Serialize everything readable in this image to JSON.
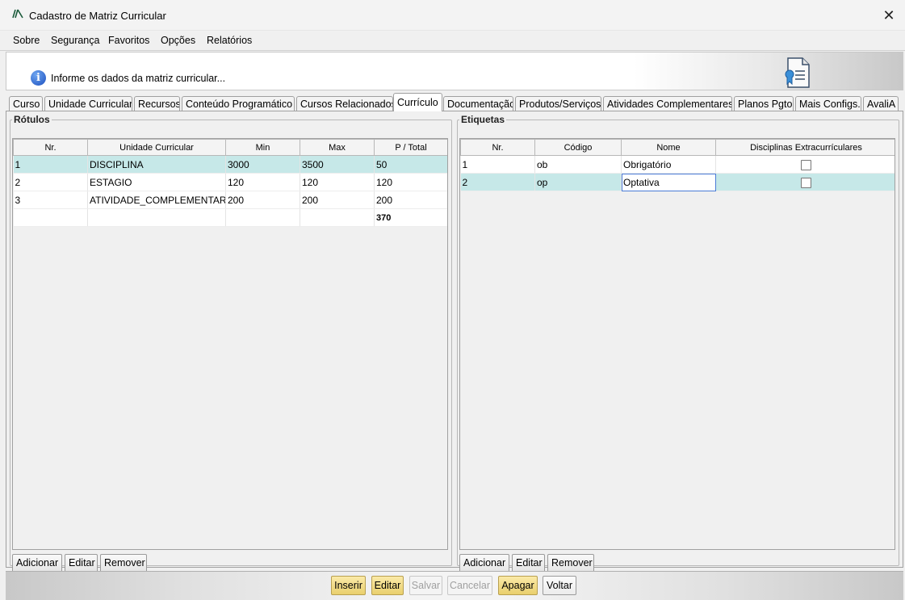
{
  "window": {
    "title": "Cadastro de Matriz Curricular",
    "close_glyph": "✕"
  },
  "menu": [
    "Sobre",
    "Segurança",
    "Favoritos",
    "Opções",
    "Relatórios"
  ],
  "info": {
    "message": "Informe os dados da matriz curricular..."
  },
  "tabs": [
    "Curso",
    "Unidade Curricular",
    "Recursos",
    "Conteúdo Programático",
    "Cursos Relacionados",
    "Currículo",
    "Documentação",
    "Produtos/Serviços",
    "Atividades Complementares",
    "Planos Pgto",
    "Mais Configs.",
    "AvaliA"
  ],
  "active_tab": "Currículo",
  "rotulos": {
    "legend": "Rótulos",
    "headers": [
      "Nr.",
      "Unidade Curricular",
      "Min",
      "Max",
      "P / Total"
    ],
    "rows": [
      [
        "1",
        "DISCIPLINA",
        "3000",
        "3500",
        "50"
      ],
      [
        "2",
        "ESTAGIO",
        "120",
        "120",
        "120"
      ],
      [
        "3",
        "ATIVIDADE_COMPLEMENTAR",
        "200",
        "200",
        "200"
      ]
    ],
    "total": "370",
    "selected_row": 0,
    "buttons": [
      "Adicionar",
      "Editar",
      "Remover"
    ]
  },
  "etiquetas": {
    "legend": "Etiquetas",
    "headers": [
      "Nr.",
      "Código",
      "Nome",
      "Disciplinas Extracurrículares"
    ],
    "rows": [
      {
        "nr": "1",
        "codigo": "ob",
        "nome": "Obrigatório",
        "extra": false
      },
      {
        "nr": "2",
        "codigo": "op",
        "nome": "Optativa",
        "extra": false
      }
    ],
    "selected_row": 1,
    "buttons": [
      "Adicionar",
      "Editar",
      "Remover"
    ]
  },
  "footer_buttons": [
    {
      "label": "Inserir",
      "state": "highlighted"
    },
    {
      "label": "Editar",
      "state": "highlighted"
    },
    {
      "label": "Salvar",
      "state": "disabled"
    },
    {
      "label": "Cancelar",
      "state": "disabled"
    },
    {
      "label": "Apagar",
      "state": "highlighted"
    },
    {
      "label": "Voltar",
      "state": "normal"
    }
  ],
  "colors": {
    "selected_row": "#c6e8e8",
    "highlight_button": "#e9cf6d",
    "focus_outline": "#4a7bd6"
  }
}
